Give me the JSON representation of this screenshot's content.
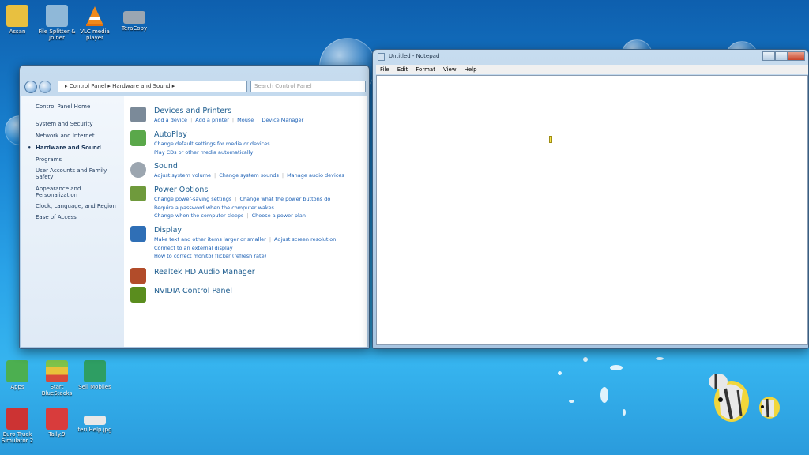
{
  "desktop": {
    "icons": [
      {
        "label": "Assan",
        "color": "#e8c040"
      },
      {
        "label": "File Splitter & Joiner",
        "color": "#8fb8d8"
      },
      {
        "label": "VLC media player",
        "color": "#f08a1c"
      },
      {
        "label": "TeraCopy",
        "color": "#9aa6b2"
      },
      {
        "label": "Apps",
        "color": "#4caf50"
      },
      {
        "label": "Start BlueStacks",
        "color": "#d8b23a"
      },
      {
        "label": "Sell Mobiles",
        "color": "#2e9e63"
      },
      {
        "label": "Euro Truck Simulator 2",
        "color": "#c33"
      },
      {
        "label": "Tally.9",
        "color": "#d83c3c"
      },
      {
        "label": "teri Help.jpg",
        "color": "#e8e8e8"
      }
    ]
  },
  "control_panel": {
    "address": "▸ Control Panel ▸ Hardware and Sound ▸",
    "search_placeholder": "Search Control Panel",
    "sidebar": [
      "Control Panel Home",
      "System and Security",
      "Network and Internet",
      "Hardware and Sound",
      "Programs",
      "User Accounts and Family Safety",
      "Appearance and Personalization",
      "Clock, Language, and Region",
      "Ease of Access"
    ],
    "categories": [
      {
        "title": "Devices and Printers",
        "color": "#7b8a99",
        "lines": [
          [
            "Add a device",
            "Add a printer",
            "Mouse",
            "Device Manager"
          ]
        ]
      },
      {
        "title": "AutoPlay",
        "color": "#5aa84a",
        "lines": [
          [
            "Change default settings for media or devices"
          ],
          [
            "Play CDs or other media automatically"
          ]
        ]
      },
      {
        "title": "Sound",
        "color": "#9ca6b0",
        "lines": [
          [
            "Adjust system volume",
            "Change system sounds",
            "Manage audio devices"
          ]
        ]
      },
      {
        "title": "Power Options",
        "color": "#6f9a3c",
        "lines": [
          [
            "Change power-saving settings",
            "Change what the power buttons do"
          ],
          [
            "Require a password when the computer wakes"
          ],
          [
            "Change when the computer sleeps",
            "Choose a power plan"
          ]
        ]
      },
      {
        "title": "Display",
        "color": "#2f6fb6",
        "lines": [
          [
            "Make text and other items larger or smaller",
            "Adjust screen resolution"
          ],
          [
            "Connect to an external display"
          ],
          [
            "How to correct monitor flicker (refresh rate)"
          ]
        ]
      },
      {
        "title": "Realtek HD Audio Manager",
        "color": "#b24c2a",
        "lines": []
      },
      {
        "title": "NVIDIA Control Panel",
        "color": "#5a8d1e",
        "lines": []
      }
    ]
  },
  "notepad": {
    "title": "Untitled - Notepad",
    "menu": [
      "File",
      "Edit",
      "Format",
      "View",
      "Help"
    ]
  }
}
